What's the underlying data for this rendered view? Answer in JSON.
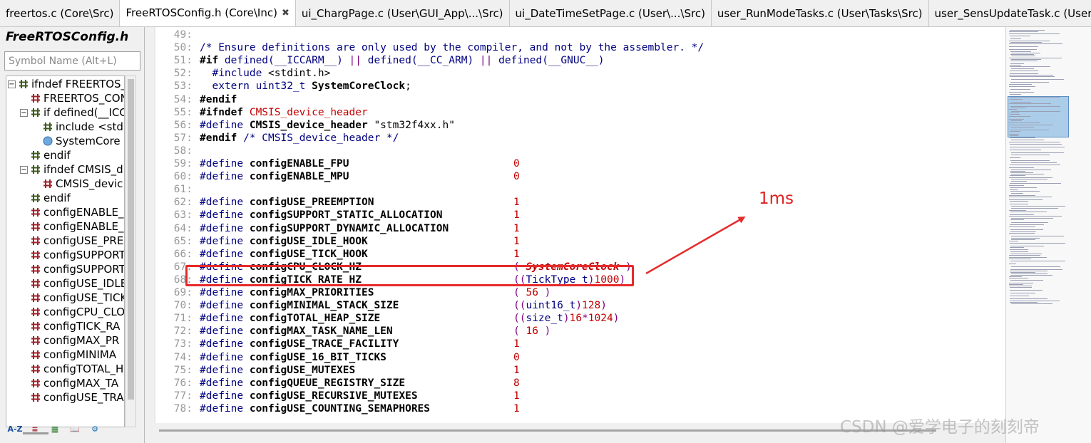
{
  "tabs": [
    {
      "label": "freertos.c (Core\\Src)",
      "active": false
    },
    {
      "label": "FreeRTOSConfig.h (Core\\Inc)",
      "active": true
    },
    {
      "label": "ui_ChargPage.c (User\\GUI_App\\...\\Src)",
      "active": false
    },
    {
      "label": "ui_DateTimeSetPage.c (User\\...\\Src)",
      "active": false
    },
    {
      "label": "user_RunModeTasks.c (User\\Tasks\\Src)",
      "active": false
    },
    {
      "label": "user_SensUpdateTask.c (User\\",
      "active": false
    }
  ],
  "tab_close": "✖",
  "symbol_panel": {
    "title": "FreeRTOSConfig.h",
    "search_placeholder": "Symbol Name (Alt+L)",
    "tree": [
      {
        "label": "ifndef FREERTOS_",
        "expander": "−",
        "icon": "hash-icon"
      },
      {
        "label": "FREERTOS_CON",
        "expander": "",
        "icon": "define-icon"
      },
      {
        "label": "if defined(__ICC",
        "expander": "−",
        "icon": "hash-icon"
      },
      {
        "label": "include <std",
        "expander": "",
        "icon": "hash-icon"
      },
      {
        "label": "SystemCore",
        "expander": "",
        "icon": "variable-icon"
      },
      {
        "label": "endif",
        "expander": "",
        "icon": "hash-icon"
      },
      {
        "label": "ifndef CMSIS_d",
        "expander": "−",
        "icon": "hash-icon"
      },
      {
        "label": "CMSIS_devic",
        "expander": "",
        "icon": "define-icon"
      },
      {
        "label": "endif",
        "expander": "",
        "icon": "hash-icon"
      },
      {
        "label": "configENABLE_",
        "expander": "",
        "icon": "define-icon"
      },
      {
        "label": "configENABLE_",
        "expander": "",
        "icon": "define-icon"
      },
      {
        "label": "configUSE_PRE",
        "expander": "",
        "icon": "define-icon"
      },
      {
        "label": "configSUPPORT",
        "expander": "",
        "icon": "define-icon"
      },
      {
        "label": "configSUPPORT",
        "expander": "",
        "icon": "define-icon"
      },
      {
        "label": "configUSE_IDLE",
        "expander": "",
        "icon": "define-icon"
      },
      {
        "label": "configUSE_TICK",
        "expander": "",
        "icon": "define-icon"
      },
      {
        "label": "configCPU_CLO",
        "expander": "",
        "icon": "define-icon"
      },
      {
        "label": "configTICK_RA",
        "expander": "",
        "icon": "define-icon"
      },
      {
        "label": "configMAX_PR",
        "expander": "",
        "icon": "define-icon"
      },
      {
        "label": "configMINIMA",
        "expander": "",
        "icon": "define-icon"
      },
      {
        "label": "configTOTAL_H",
        "expander": "",
        "icon": "define-icon"
      },
      {
        "label": "configMAX_TA",
        "expander": "",
        "icon": "define-icon"
      },
      {
        "label": "configUSE_TRA",
        "expander": "",
        "icon": "define-icon"
      }
    ],
    "toolbar": [
      {
        "name": "sort-az-icon",
        "glyph": "A-Z"
      },
      {
        "name": "list-view-icon",
        "glyph": "≡"
      },
      {
        "name": "category-view-icon",
        "glyph": "▦"
      },
      {
        "name": "book-icon",
        "glyph": "📖"
      },
      {
        "name": "settings-icon",
        "glyph": "⚙"
      }
    ]
  },
  "code_lines": [
    {
      "n": "49:",
      "parts": []
    },
    {
      "n": "50:",
      "parts": [
        {
          "t": "/* Ensure definitions are only used by the compiler, and not by the assembler. */",
          "c": "cmt"
        }
      ]
    },
    {
      "n": "51:",
      "parts": [
        {
          "t": "#if",
          "c": "nm"
        },
        {
          "t": " defined(",
          "c": "kw"
        },
        {
          "t": "__ICCARM__",
          "c": "kw"
        },
        {
          "t": ")",
          "c": "kw"
        },
        {
          "t": " || ",
          "c": "par"
        },
        {
          "t": "defined(",
          "c": "kw"
        },
        {
          "t": "__CC_ARM",
          "c": "kw"
        },
        {
          "t": ")",
          "c": "kw"
        },
        {
          "t": " || ",
          "c": "par"
        },
        {
          "t": "defined(",
          "c": "kw"
        },
        {
          "t": "__GNUC__",
          "c": "kw"
        },
        {
          "t": ")",
          "c": "kw"
        }
      ]
    },
    {
      "n": "52:",
      "parts": [
        {
          "t": "  #include ",
          "c": "kw"
        },
        {
          "t": "<stdint.h>",
          "c": "str"
        }
      ]
    },
    {
      "n": "53:",
      "parts": [
        {
          "t": "  extern ",
          "c": "kw"
        },
        {
          "t": "uint32_t ",
          "c": "kw"
        },
        {
          "t": "SystemCoreClock",
          "c": "nm"
        },
        {
          "t": ";",
          "c": "str"
        }
      ]
    },
    {
      "n": "54:",
      "parts": [
        {
          "t": "#endif",
          "c": "nm"
        }
      ]
    },
    {
      "n": "55:",
      "parts": [
        {
          "t": "#ifndef ",
          "c": "nm"
        },
        {
          "t": "CMSIS_device_header",
          "c": "num"
        }
      ]
    },
    {
      "n": "56:",
      "parts": [
        {
          "t": "#define ",
          "c": "kw"
        },
        {
          "t": "CMSIS_device_header",
          "c": "nm"
        },
        {
          "t": " \"stm32f4xx.h\"",
          "c": "str"
        }
      ]
    },
    {
      "n": "57:",
      "parts": [
        {
          "t": "#endif",
          "c": "nm"
        },
        {
          "t": " /* CMSIS_device_header */",
          "c": "cmt"
        }
      ]
    },
    {
      "n": "58:",
      "parts": []
    },
    {
      "n": "59:",
      "parts": [
        {
          "t": "#define ",
          "c": "kw"
        },
        {
          "t": "configENABLE_FPU",
          "c": "nm"
        }
      ],
      "value": [
        {
          "t": "0",
          "c": "num"
        }
      ]
    },
    {
      "n": "60:",
      "parts": [
        {
          "t": "#define ",
          "c": "kw"
        },
        {
          "t": "configENABLE_MPU",
          "c": "nm"
        }
      ],
      "value": [
        {
          "t": "0",
          "c": "num"
        }
      ]
    },
    {
      "n": "61:",
      "parts": []
    },
    {
      "n": "62:",
      "parts": [
        {
          "t": "#define ",
          "c": "kw"
        },
        {
          "t": "configUSE_PREEMPTION",
          "c": "nm"
        }
      ],
      "value": [
        {
          "t": "1",
          "c": "num"
        }
      ]
    },
    {
      "n": "63:",
      "parts": [
        {
          "t": "#define ",
          "c": "kw"
        },
        {
          "t": "configSUPPORT_STATIC_ALLOCATION",
          "c": "nm"
        }
      ],
      "value": [
        {
          "t": "1",
          "c": "num"
        }
      ]
    },
    {
      "n": "64:",
      "parts": [
        {
          "t": "#define ",
          "c": "kw"
        },
        {
          "t": "configSUPPORT_DYNAMIC_ALLOCATION",
          "c": "nm"
        }
      ],
      "value": [
        {
          "t": "1",
          "c": "num"
        }
      ]
    },
    {
      "n": "65:",
      "parts": [
        {
          "t": "#define ",
          "c": "kw"
        },
        {
          "t": "configUSE_IDLE_HOOK",
          "c": "nm"
        }
      ],
      "value": [
        {
          "t": "1",
          "c": "num"
        }
      ]
    },
    {
      "n": "66:",
      "parts": [
        {
          "t": "#define ",
          "c": "kw"
        },
        {
          "t": "configUSE_TICK_HOOK",
          "c": "nm"
        }
      ],
      "value": [
        {
          "t": "1",
          "c": "num"
        }
      ]
    },
    {
      "n": "67:",
      "parts": [
        {
          "t": "#define ",
          "c": "kw"
        },
        {
          "t": "configCPU_CLOCK_HZ",
          "c": "nm"
        }
      ],
      "value": [
        {
          "t": "( ",
          "c": "par"
        },
        {
          "t": "SystemCoreClock",
          "c": "ital"
        },
        {
          "t": " )",
          "c": "par"
        }
      ]
    },
    {
      "n": "68:",
      "parts": [
        {
          "t": "#define ",
          "c": "kw"
        },
        {
          "t": "configTICK_RATE_HZ",
          "c": "nm"
        }
      ],
      "value": [
        {
          "t": "((",
          "c": "par"
        },
        {
          "t": "TickType_t",
          "c": "kw"
        },
        {
          "t": ")",
          "c": "par"
        },
        {
          "t": "1000",
          "c": "num"
        },
        {
          "t": ")",
          "c": "par"
        }
      ]
    },
    {
      "n": "69:",
      "parts": [
        {
          "t": "#define ",
          "c": "kw"
        },
        {
          "t": "configMAX_PRIORITIES",
          "c": "nm"
        }
      ],
      "value": [
        {
          "t": "( ",
          "c": "par"
        },
        {
          "t": "56",
          "c": "num"
        },
        {
          "t": " )",
          "c": "par"
        }
      ]
    },
    {
      "n": "70:",
      "parts": [
        {
          "t": "#define ",
          "c": "kw"
        },
        {
          "t": "configMINIMAL_STACK_SIZE",
          "c": "nm"
        }
      ],
      "value": [
        {
          "t": "((",
          "c": "par"
        },
        {
          "t": "uint16_t",
          "c": "kw"
        },
        {
          "t": ")",
          "c": "par"
        },
        {
          "t": "128",
          "c": "num"
        },
        {
          "t": ")",
          "c": "par"
        }
      ]
    },
    {
      "n": "71:",
      "parts": [
        {
          "t": "#define ",
          "c": "kw"
        },
        {
          "t": "configTOTAL_HEAP_SIZE",
          "c": "nm"
        }
      ],
      "value": [
        {
          "t": "((",
          "c": "par"
        },
        {
          "t": "size_t",
          "c": "kw"
        },
        {
          "t": ")",
          "c": "par"
        },
        {
          "t": "16",
          "c": "num"
        },
        {
          "t": "*",
          "c": "par"
        },
        {
          "t": "1024",
          "c": "num"
        },
        {
          "t": ")",
          "c": "par"
        }
      ]
    },
    {
      "n": "72:",
      "parts": [
        {
          "t": "#define ",
          "c": "kw"
        },
        {
          "t": "configMAX_TASK_NAME_LEN",
          "c": "nm"
        }
      ],
      "value": [
        {
          "t": "( ",
          "c": "par"
        },
        {
          "t": "16",
          "c": "num"
        },
        {
          "t": " )",
          "c": "par"
        }
      ]
    },
    {
      "n": "73:",
      "parts": [
        {
          "t": "#define ",
          "c": "kw"
        },
        {
          "t": "configUSE_TRACE_FACILITY",
          "c": "nm"
        }
      ],
      "value": [
        {
          "t": "1",
          "c": "num"
        }
      ]
    },
    {
      "n": "74:",
      "parts": [
        {
          "t": "#define ",
          "c": "kw"
        },
        {
          "t": "configUSE_16_BIT_TICKS",
          "c": "nm"
        }
      ],
      "value": [
        {
          "t": "0",
          "c": "num"
        }
      ]
    },
    {
      "n": "75:",
      "parts": [
        {
          "t": "#define ",
          "c": "kw"
        },
        {
          "t": "configUSE_MUTEXES",
          "c": "nm"
        }
      ],
      "value": [
        {
          "t": "1",
          "c": "num"
        }
      ]
    },
    {
      "n": "76:",
      "parts": [
        {
          "t": "#define ",
          "c": "kw"
        },
        {
          "t": "configQUEUE_REGISTRY_SIZE",
          "c": "nm"
        }
      ],
      "value": [
        {
          "t": "8",
          "c": "num"
        }
      ]
    },
    {
      "n": "77:",
      "parts": [
        {
          "t": "#define ",
          "c": "kw"
        },
        {
          "t": "configUSE_RECURSIVE_MUTEXES",
          "c": "nm"
        }
      ],
      "value": [
        {
          "t": "1",
          "c": "num"
        }
      ]
    },
    {
      "n": "78:",
      "parts": [
        {
          "t": "#define ",
          "c": "kw"
        },
        {
          "t": "configUSE_COUNTING_SEMAPHORES",
          "c": "nm"
        }
      ],
      "value": [
        {
          "t": "1",
          "c": "num"
        }
      ]
    }
  ],
  "annotation": {
    "text": "1ms",
    "color": "#e62a2a"
  },
  "watermark": "CSDN @爱学电子的刻刻帝",
  "colors": {
    "highlight_box": "#e62a2a",
    "keyword": "#000080",
    "number": "#c00000",
    "operator": "#800080"
  }
}
